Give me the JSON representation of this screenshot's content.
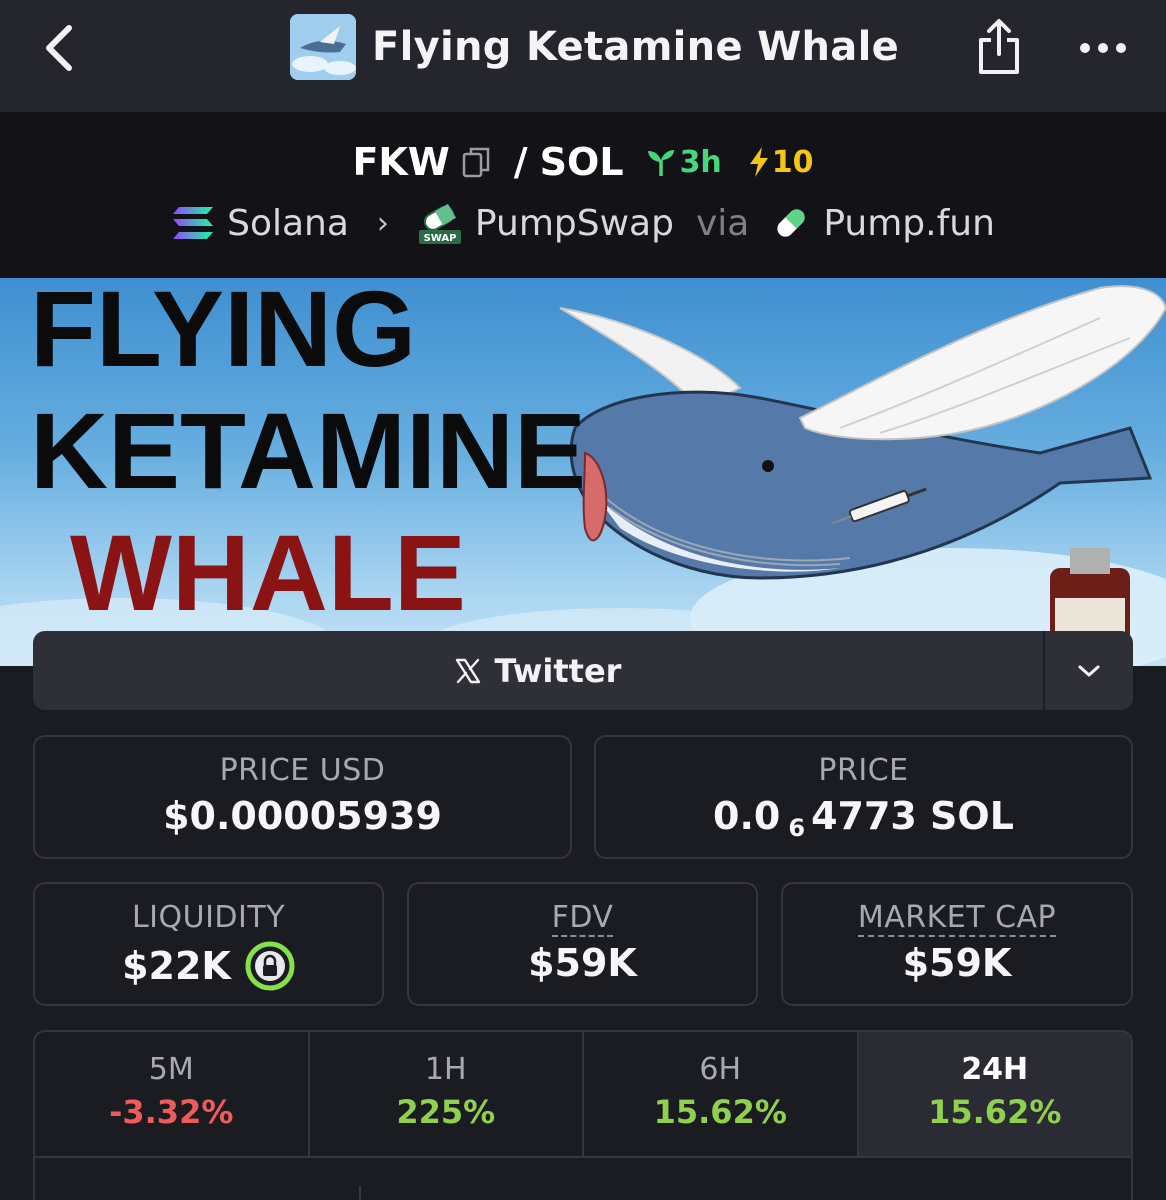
{
  "header": {
    "title": "Flying Ketamine Whale"
  },
  "pair": {
    "base": "FKW",
    "separator": "/",
    "quote": "SOL",
    "age": "3h",
    "boosts": "10"
  },
  "route": {
    "chain": "Solana",
    "dex": "PumpSwap",
    "via": "via",
    "launchpad": "Pump.fun",
    "dex_icon_text": "SWAP"
  },
  "banner": {
    "line1": "FLYING",
    "line2": "KETAMINE",
    "line3": "WHALE"
  },
  "social": {
    "twitter_label": "Twitter"
  },
  "stats": {
    "price_usd_label": "PRICE USD",
    "price_usd_value": "$0.00005939",
    "price_label": "PRICE",
    "price_prefix": "0.0",
    "price_zeros": "6",
    "price_suffix": "4773 SOL",
    "liquidity_label": "LIQUIDITY",
    "liquidity_value": "$22K",
    "fdv_label": "FDV",
    "fdv_value": "$59K",
    "mcap_label": "MARKET CAP",
    "mcap_value": "$59K"
  },
  "timeframes": [
    {
      "label": "5M",
      "value": "-3.32%",
      "color": "#ef5a5a"
    },
    {
      "label": "1H",
      "value": "225%",
      "color": "#8fd14f"
    },
    {
      "label": "6H",
      "value": "15.62%",
      "color": "#8fd14f"
    },
    {
      "label": "24H",
      "value": "15.62%",
      "color": "#8fd14f"
    }
  ],
  "colors": {
    "accent_green": "#47d67a",
    "boost_yellow": "#f5c518",
    "negative": "#ef5a5a",
    "positive": "#8fd14f"
  }
}
